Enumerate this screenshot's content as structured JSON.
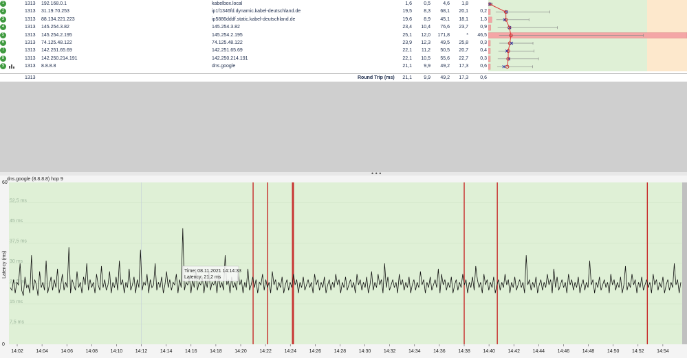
{
  "hops": [
    {
      "hop": "1",
      "count": "1313",
      "ip": "192.168.0.1",
      "name": "kabelbox.local",
      "avg": "1,6",
      "min": "0,5",
      "max": "4,6",
      "cur": "1,8",
      "pl": ""
    },
    {
      "hop": "2",
      "count": "1313",
      "ip": "31.19.70.253",
      "name": "ip1f1346fd.dynamic.kabel-deutschland.de",
      "avg": "19,5",
      "min": "8,3",
      "max": "68,1",
      "cur": "20,1",
      "pl": "0,2"
    },
    {
      "hop": "3",
      "count": "1313",
      "ip": "88.134.221.223",
      "name": "ip5886dddf.static.kabel-deutschland.de",
      "avg": "19,6",
      "min": "8,9",
      "max": "45,1",
      "cur": "18,1",
      "pl": "1,3"
    },
    {
      "hop": "4",
      "count": "1313",
      "ip": "145.254.3.82",
      "name": "145.254.3.82",
      "avg": "23,4",
      "min": "10,4",
      "max": "76,6",
      "cur": "23,7",
      "pl": "0,9"
    },
    {
      "hop": "5",
      "count": "1313",
      "ip": "145.254.2.195",
      "name": "145.254.2.195",
      "avg": "25,1",
      "min": "12,0",
      "max": "171,8",
      "cur": "*",
      "pl": "46,5"
    },
    {
      "hop": "6",
      "count": "1313",
      "ip": "74.125.48.122",
      "name": "74.125.48.122",
      "avg": "23,9",
      "min": "12,3",
      "max": "49,5",
      "cur": "25,8",
      "pl": "0,3"
    },
    {
      "hop": "7",
      "count": "1313",
      "ip": "142.251.65.69",
      "name": "142.251.65.69",
      "avg": "22,1",
      "min": "11,2",
      "max": "50,5",
      "cur": "20,7",
      "pl": "0,4"
    },
    {
      "hop": "8",
      "count": "1313",
      "ip": "142.250.214.191",
      "name": "142.250.214.191",
      "avg": "22,1",
      "min": "10,5",
      "max": "55,6",
      "cur": "22,7",
      "pl": "0,3"
    },
    {
      "hop": "9",
      "count": "1313",
      "ip": "8.8.8.8",
      "name": "dns.google",
      "avg": "21,1",
      "min": "9,9",
      "max": "49,2",
      "cur": "17,3",
      "pl": "0,6"
    }
  ],
  "summary": {
    "count": "1313",
    "label": "Round Trip (ms)",
    "avg": "21,1",
    "min": "9,9",
    "max": "49,2",
    "cur": "17,3",
    "pl": "0,6"
  },
  "colors": {
    "accent": "#3f9a3f",
    "loss": "#f4a6a6",
    "graph_bg": "#dff0d6",
    "red_line": "#c62828",
    "trace": "#111111"
  },
  "chart_title": "dns.google (8.8.8.8) hop 9",
  "tooltip": {
    "time": "Time: 08.11.2021 14:14:33",
    "latency": "Latency: 21,2 ms"
  },
  "chart_data": {
    "type": "line",
    "title": "dns.google (8.8.8.8) hop 9",
    "xlabel": "",
    "ylabel": "Latency (ms)",
    "ylim": [
      0,
      60
    ],
    "y_ticks": [
      "0",
      "7,5 ms",
      "15 ms",
      "22,5 ms",
      "30 ms",
      "37,5 ms",
      "45 ms",
      "52,5 ms",
      "60"
    ],
    "x_ticks": [
      "14:02",
      "14:04",
      "14:06",
      "14:08",
      "14:10",
      "14:12",
      "14:14",
      "14:16",
      "14:18",
      "14:20",
      "14:22",
      "14:24",
      "14:26",
      "14:28",
      "14:30",
      "14:32",
      "14:34",
      "14:36",
      "14:38",
      "14:40",
      "14:42",
      "14:44",
      "14:46",
      "14:48",
      "14:50",
      "14:52",
      "14:54"
    ],
    "loss_events": [
      "14:21:00",
      "14:22:10",
      "14:24:10",
      "14:24:15",
      "14:38:00",
      "14:40:40",
      "14:52:45"
    ],
    "series": [
      {
        "name": "dns.google",
        "values": [
          21,
          20,
          24,
          19,
          23,
          22,
          30,
          20,
          18,
          25,
          21,
          22,
          19,
          33,
          20,
          24,
          22,
          18,
          27,
          21,
          23,
          20,
          31,
          19,
          22,
          25,
          20,
          24,
          21,
          28,
          19,
          22,
          26,
          20,
          23,
          21,
          36,
          19,
          24,
          22,
          20,
          27,
          21,
          23,
          19,
          25,
          22,
          30,
          20,
          24,
          21,
          23,
          19,
          26,
          22,
          20,
          29,
          21,
          24,
          20,
          22,
          27,
          19,
          23,
          21,
          25,
          20,
          31,
          22,
          24,
          19,
          23,
          21,
          28,
          20,
          22,
          25,
          19,
          24,
          21,
          35,
          20,
          23,
          22,
          26,
          19,
          24,
          21,
          22,
          30,
          20,
          23,
          21,
          25,
          19,
          22,
          27,
          21,
          24,
          20,
          23,
          22,
          26,
          19,
          24,
          21,
          43,
          20,
          23,
          22,
          25,
          19,
          24,
          21,
          28,
          20,
          23,
          22,
          25,
          19,
          24,
          21,
          27,
          20,
          23,
          22,
          24,
          19,
          26,
          21,
          23,
          20,
          33,
          22,
          24,
          19,
          25,
          21,
          23,
          20,
          27,
          22,
          24,
          19,
          23,
          21,
          28,
          20,
          22,
          25,
          21,
          24,
          19,
          23,
          22,
          26,
          20,
          24,
          21,
          23,
          19,
          27,
          22,
          24,
          20,
          23,
          21,
          25,
          19,
          22,
          24,
          20,
          23,
          21,
          26,
          22,
          24,
          19,
          23,
          21,
          25,
          20,
          22,
          24,
          21,
          23,
          19,
          26,
          22,
          24,
          20,
          23,
          21,
          25,
          19,
          22,
          24,
          20,
          23,
          21,
          26,
          22,
          24,
          19,
          23,
          21,
          25,
          20,
          22,
          24,
          21,
          23,
          19,
          26,
          22,
          24,
          20,
          23,
          21,
          25,
          19,
          22,
          27,
          20,
          23,
          21,
          26,
          22,
          24,
          19,
          30,
          21,
          25,
          20,
          22,
          24,
          21,
          23,
          19,
          26,
          22,
          24,
          20,
          23,
          21,
          25,
          19,
          22,
          24,
          20,
          23,
          21,
          27,
          22,
          24,
          19,
          23,
          21,
          25,
          20,
          22,
          24,
          21,
          28,
          19,
          26,
          22,
          24,
          20,
          23,
          21,
          25,
          19,
          22,
          24,
          20,
          23,
          21,
          26,
          22,
          24,
          19,
          23,
          21,
          25,
          20,
          29,
          24,
          21,
          23,
          19,
          26,
          22,
          24,
          20,
          23,
          21,
          25,
          19,
          22,
          24,
          20,
          23,
          21,
          26,
          22,
          24,
          19,
          23,
          21,
          25,
          20,
          22,
          24,
          21,
          23,
          19,
          33,
          22,
          24,
          20,
          23,
          21,
          25,
          19,
          22,
          24,
          20,
          23,
          21,
          26,
          22,
          24,
          19,
          28,
          21,
          25,
          20,
          22,
          24,
          21,
          23,
          19,
          26,
          22,
          24,
          20,
          23,
          21,
          25,
          19,
          22,
          24,
          20,
          23,
          21,
          31,
          22,
          24,
          19,
          23,
          21,
          25,
          20,
          22,
          24,
          21,
          23,
          19,
          26,
          22,
          24,
          20,
          23,
          21,
          25,
          19,
          22,
          29,
          20,
          23,
          21,
          26,
          22,
          24,
          19,
          23,
          21,
          25,
          20,
          22,
          24,
          21,
          23,
          19,
          26,
          22,
          24,
          20,
          23,
          21,
          25,
          19,
          22,
          24,
          20,
          23,
          21,
          30,
          22,
          24,
          19,
          23
        ]
      }
    ]
  }
}
